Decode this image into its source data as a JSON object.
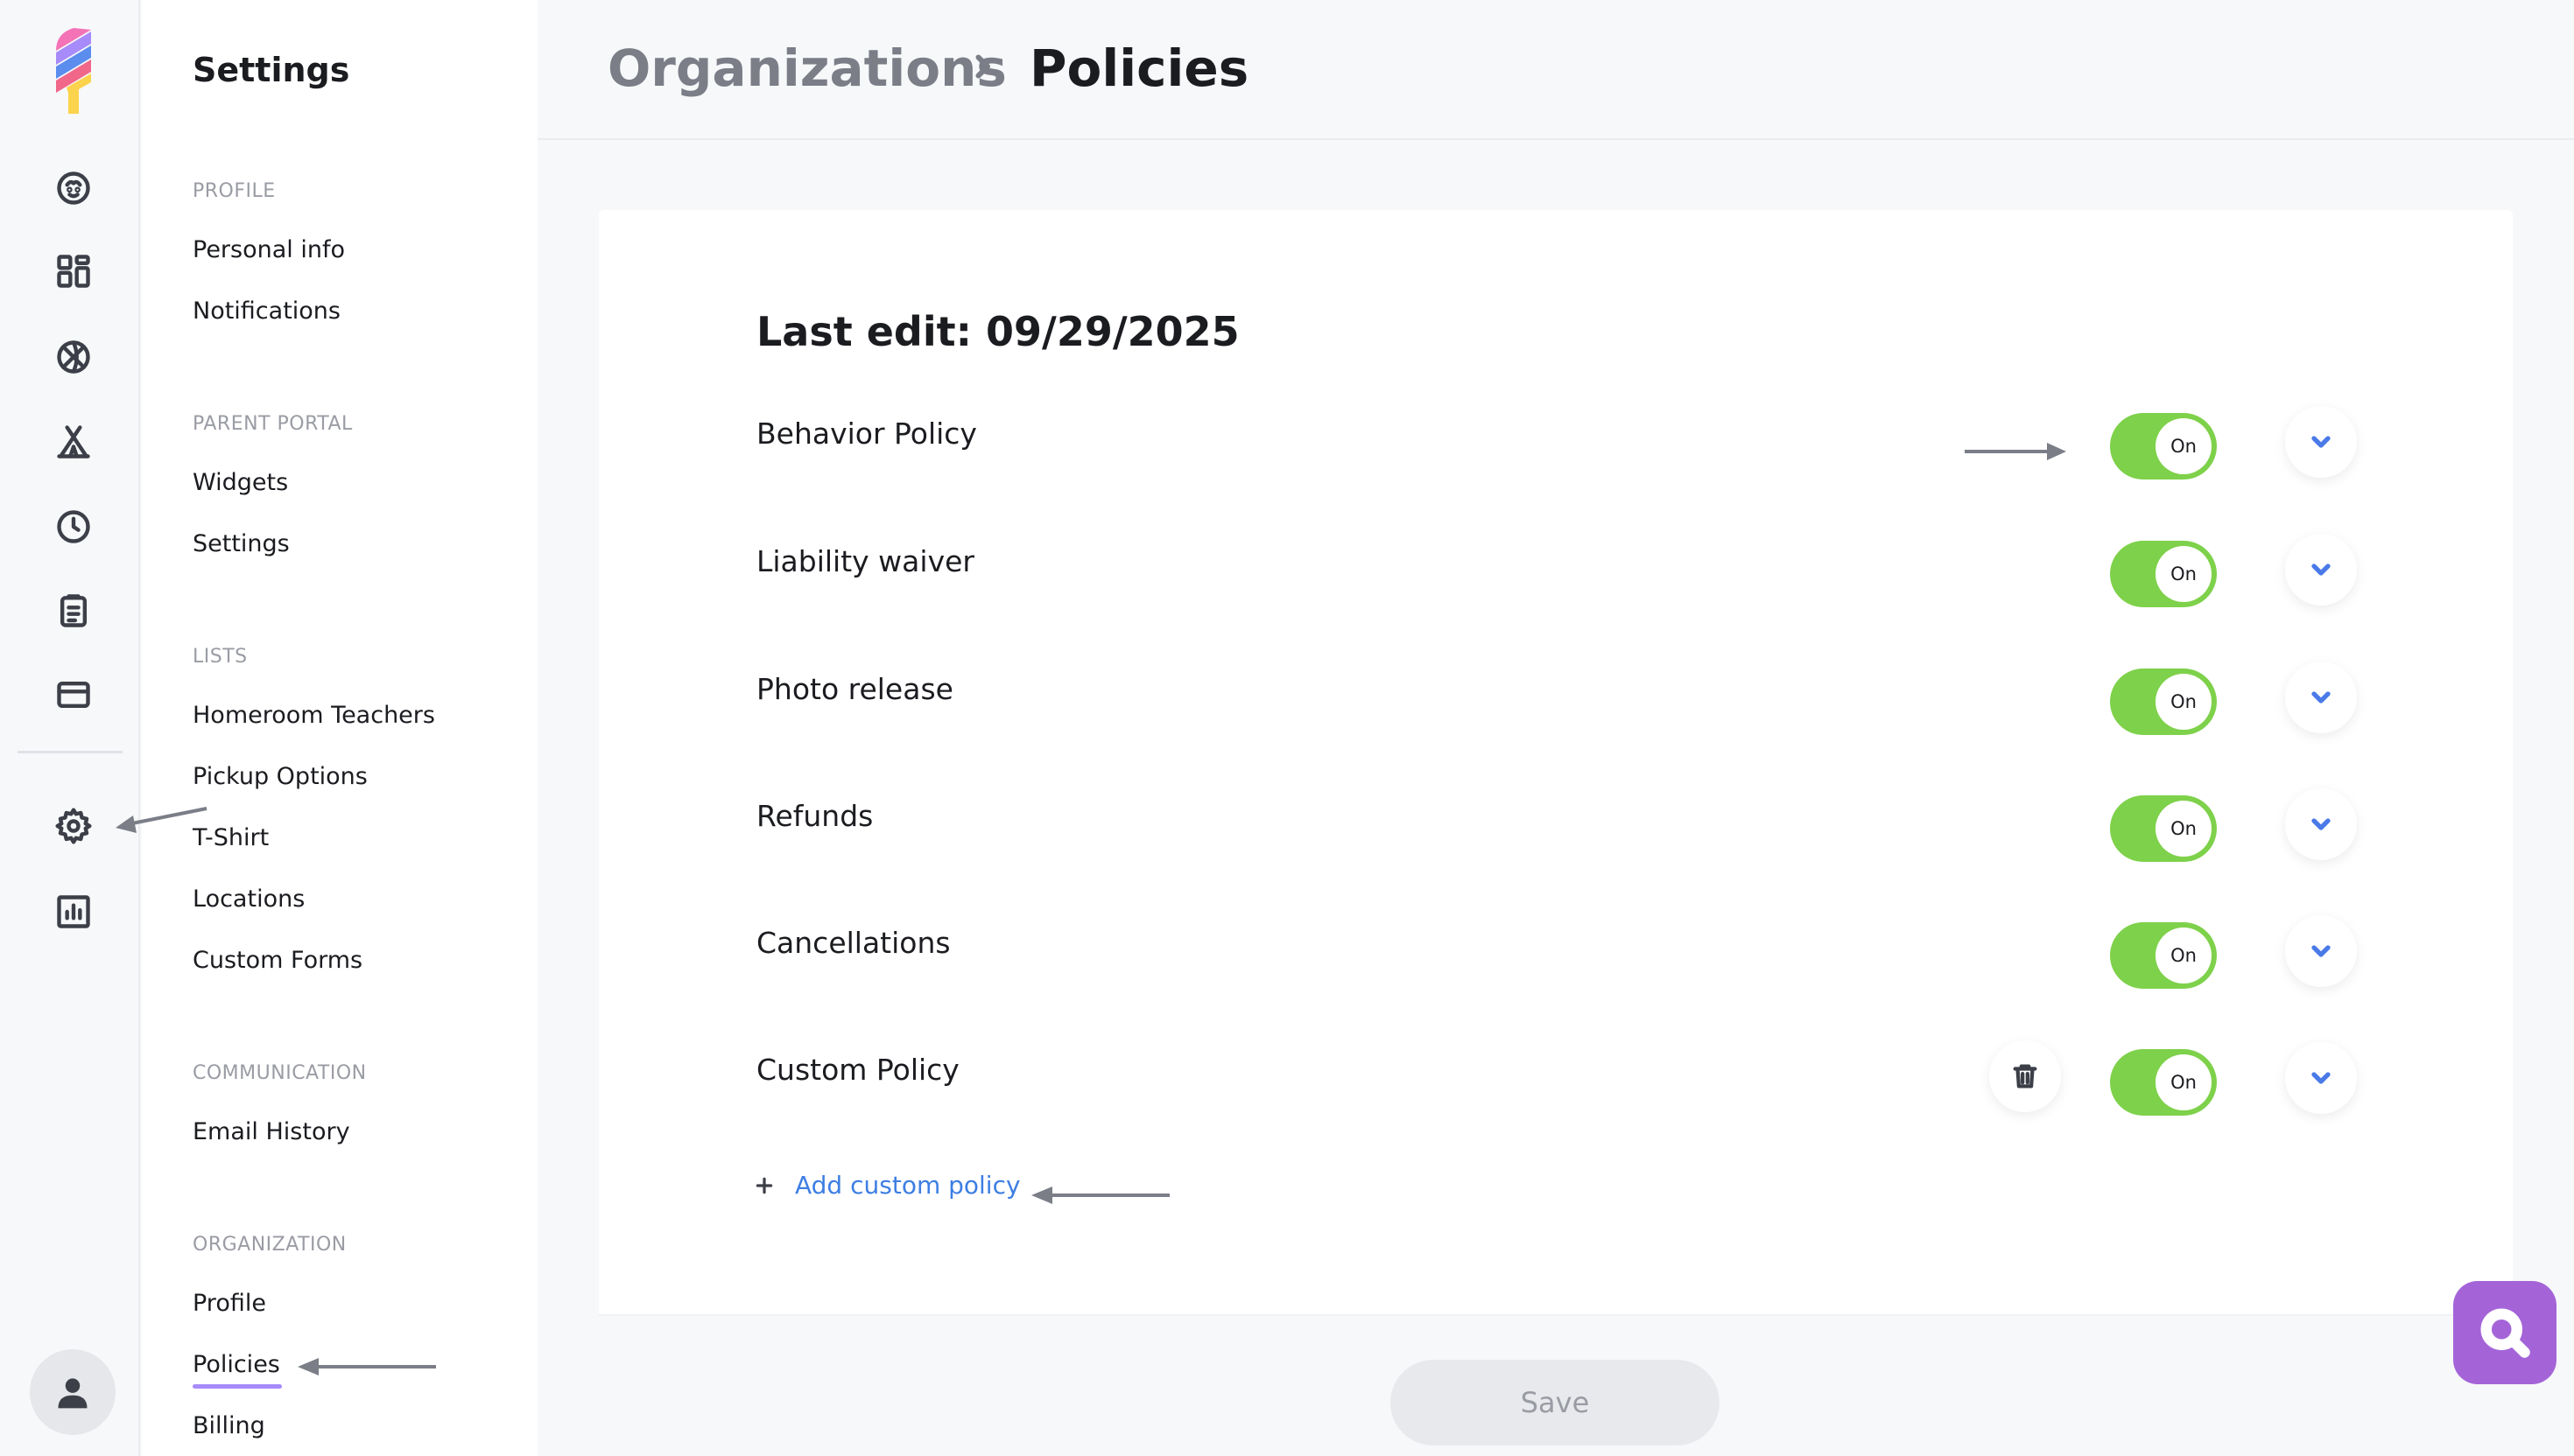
{
  "menu": {
    "title": "Settings",
    "sections": {
      "profile": "PROFILE",
      "parent_portal": "PARENT PORTAL",
      "lists": "LISTS",
      "communication": "COMMUNICATION",
      "organization": "ORGANIZATION"
    },
    "items": {
      "personal_info": "Personal info",
      "notifications": "Notifications",
      "widgets": "Widgets",
      "settings": "Settings",
      "homeroom_teachers": "Homeroom Teachers",
      "pickup_options": "Pickup Options",
      "t_shirt": "T-Shirt",
      "locations": "Locations",
      "custom_forms": "Custom Forms",
      "email_history": "Email History",
      "org_profile": "Profile",
      "policies": "Policies",
      "billing": "Billing"
    },
    "active_item": "Policies"
  },
  "header": {
    "breadcrumb_parent": "Organizations",
    "breadcrumb_current": "Policies"
  },
  "content": {
    "last_edit": "Last edit: 09/29/2025",
    "policies": [
      {
        "label": "Behavior Policy",
        "toggle": "On",
        "enabled": true
      },
      {
        "label": "Liability waiver",
        "toggle": "On",
        "enabled": true
      },
      {
        "label": "Photo release",
        "toggle": "On",
        "enabled": true
      },
      {
        "label": "Refunds",
        "toggle": "On",
        "enabled": true
      },
      {
        "label": "Cancellations",
        "toggle": "On",
        "enabled": true
      },
      {
        "label": "Custom Policy",
        "toggle": "On",
        "enabled": true,
        "deletable": true
      }
    ],
    "add_custom_policy": "Add custom policy",
    "save_label": "Save"
  },
  "rail_icons": [
    "logo-icon",
    "child-face-icon",
    "dashboard-icon",
    "sports-ball-icon",
    "camp-tent-icon",
    "clock-icon",
    "clipboard-icon",
    "credit-card-icon",
    "gear-icon",
    "bar-chart-icon",
    "user-avatar-icon"
  ],
  "colors": {
    "toggle_on": "#7ed14a",
    "link_blue": "#3d7ee3",
    "chevron_blue": "#4a7ae8",
    "active_underline": "#a78bfa",
    "help_bubble": "#a464d8"
  }
}
